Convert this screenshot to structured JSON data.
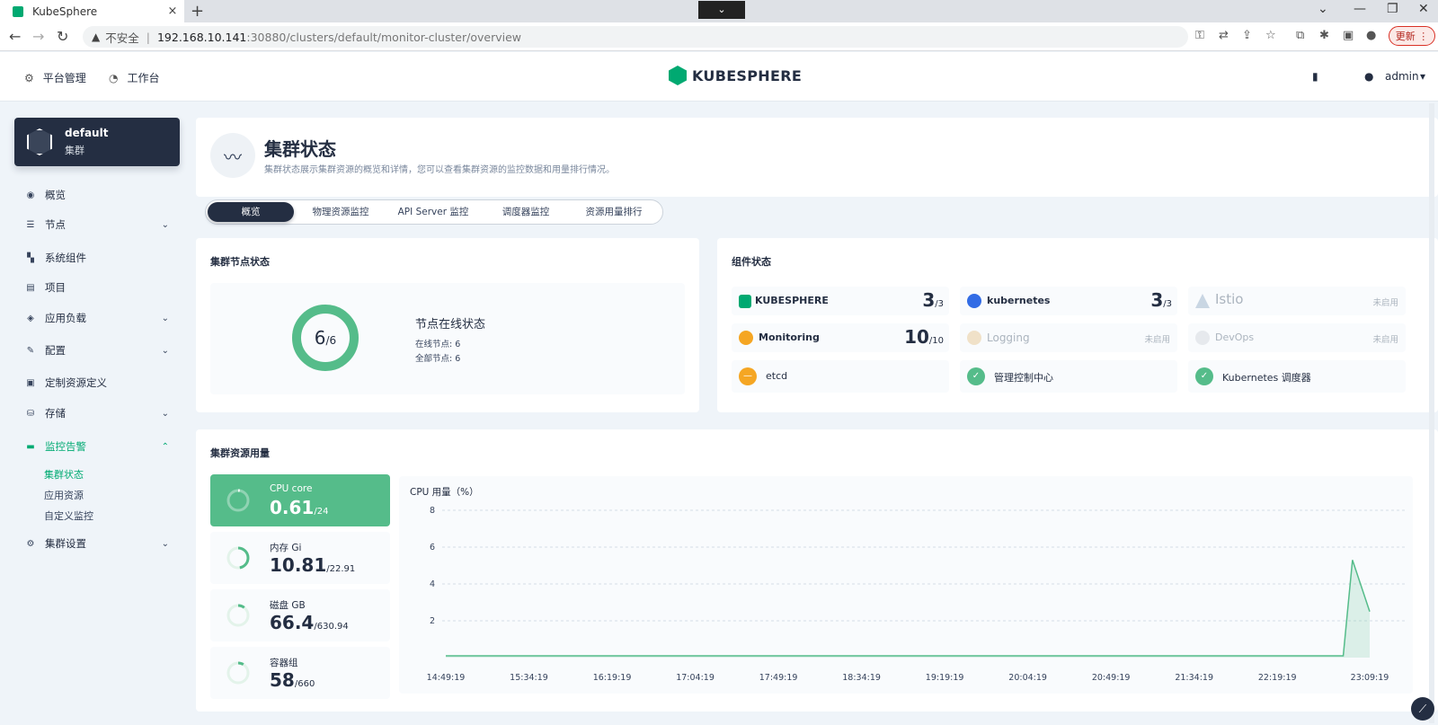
{
  "browser": {
    "tab_title": "KubeSphere",
    "new_tab": "+",
    "close": "×",
    "insecure_label": "不安全",
    "url_host": "192.168.10.141",
    "url_path": ":30880/clusters/default/monitor-cluster/overview",
    "update_label": "更新"
  },
  "header": {
    "platform_label": "平台管理",
    "workbench_label": "工作台",
    "logo_text": "KUBESPHERE",
    "user": "admin"
  },
  "sidebar": {
    "cluster_name": "default",
    "cluster_sub": "集群",
    "items": [
      {
        "label": "概览"
      },
      {
        "label": "节点"
      },
      {
        "label": "系统组件"
      },
      {
        "label": "项目"
      },
      {
        "label": "应用负载"
      },
      {
        "label": "配置"
      },
      {
        "label": "定制资源定义"
      },
      {
        "label": "存储"
      },
      {
        "label": "监控告警"
      },
      {
        "label": "集群设置"
      }
    ],
    "monitor_sub": [
      "集群状态",
      "应用资源",
      "自定义监控"
    ]
  },
  "banner": {
    "title": "集群状态",
    "desc": "集群状态展示集群资源的概览和详情，您可以查看集群资源的监控数据和用量排行情况。"
  },
  "tabs": [
    "概览",
    "物理资源监控",
    "API Server 监控",
    "调度器监控",
    "资源用量排行"
  ],
  "node_status": {
    "title": "集群节点状态",
    "online": "6",
    "total_slash": "/6",
    "online_ratio": 1.0,
    "status_title": "节点在线状态",
    "online_line": "在线节点: 6",
    "total_line": "全部节点: 6"
  },
  "components": {
    "title": "组件状态",
    "disabled_label": "未启用",
    "items": [
      {
        "name": "KUBESPHERE",
        "count": "3",
        "total": "/3"
      },
      {
        "name": "kubernetes",
        "count": "3",
        "total": "/3"
      },
      {
        "name": "Istio"
      },
      {
        "name": "Monitoring",
        "count": "10",
        "total": "/10"
      },
      {
        "name": "Logging"
      },
      {
        "name": "DevOps"
      },
      {
        "name": "etcd"
      },
      {
        "name": "管理控制中心"
      },
      {
        "name": "Kubernetes 调度器"
      }
    ]
  },
  "resources": {
    "title": "集群资源用量",
    "items": [
      {
        "label": "CPU core",
        "value": "0.61",
        "total": "/24",
        "ratio": 0.025
      },
      {
        "label": "内存 Gi",
        "value": "10.81",
        "total": "/22.91",
        "ratio": 0.47
      },
      {
        "label": "磁盘 GB",
        "value": "66.4",
        "total": "/630.94",
        "ratio": 0.105
      },
      {
        "label": "容器组",
        "value": "58",
        "total": "/660",
        "ratio": 0.088
      }
    ]
  },
  "chart_data": {
    "type": "area",
    "ylabel": "CPU 用量（%）",
    "ylim": [
      0,
      8
    ],
    "yticks": [
      2,
      4,
      6,
      8
    ],
    "categories": [
      "14:49:19",
      "15:34:19",
      "16:19:19",
      "17:04:19",
      "17:49:19",
      "18:34:19",
      "19:19:19",
      "20:04:19",
      "20:49:19",
      "21:34:19",
      "22:19:19",
      "23:09:19"
    ],
    "x": [
      "14:49:19",
      "15:34:19",
      "16:19:19",
      "17:04:19",
      "17:49:19",
      "18:34:19",
      "19:19:19",
      "20:04:19",
      "20:49:19",
      "21:34:19",
      "22:19:19",
      "22:55:00",
      "23:00:00",
      "23:09:19"
    ],
    "values": [
      0.1,
      0.1,
      0.1,
      0.1,
      0.1,
      0.1,
      0.1,
      0.1,
      0.1,
      0.1,
      0.1,
      0.1,
      5.3,
      2.5
    ],
    "grid": true,
    "color": "#55bc8a"
  }
}
